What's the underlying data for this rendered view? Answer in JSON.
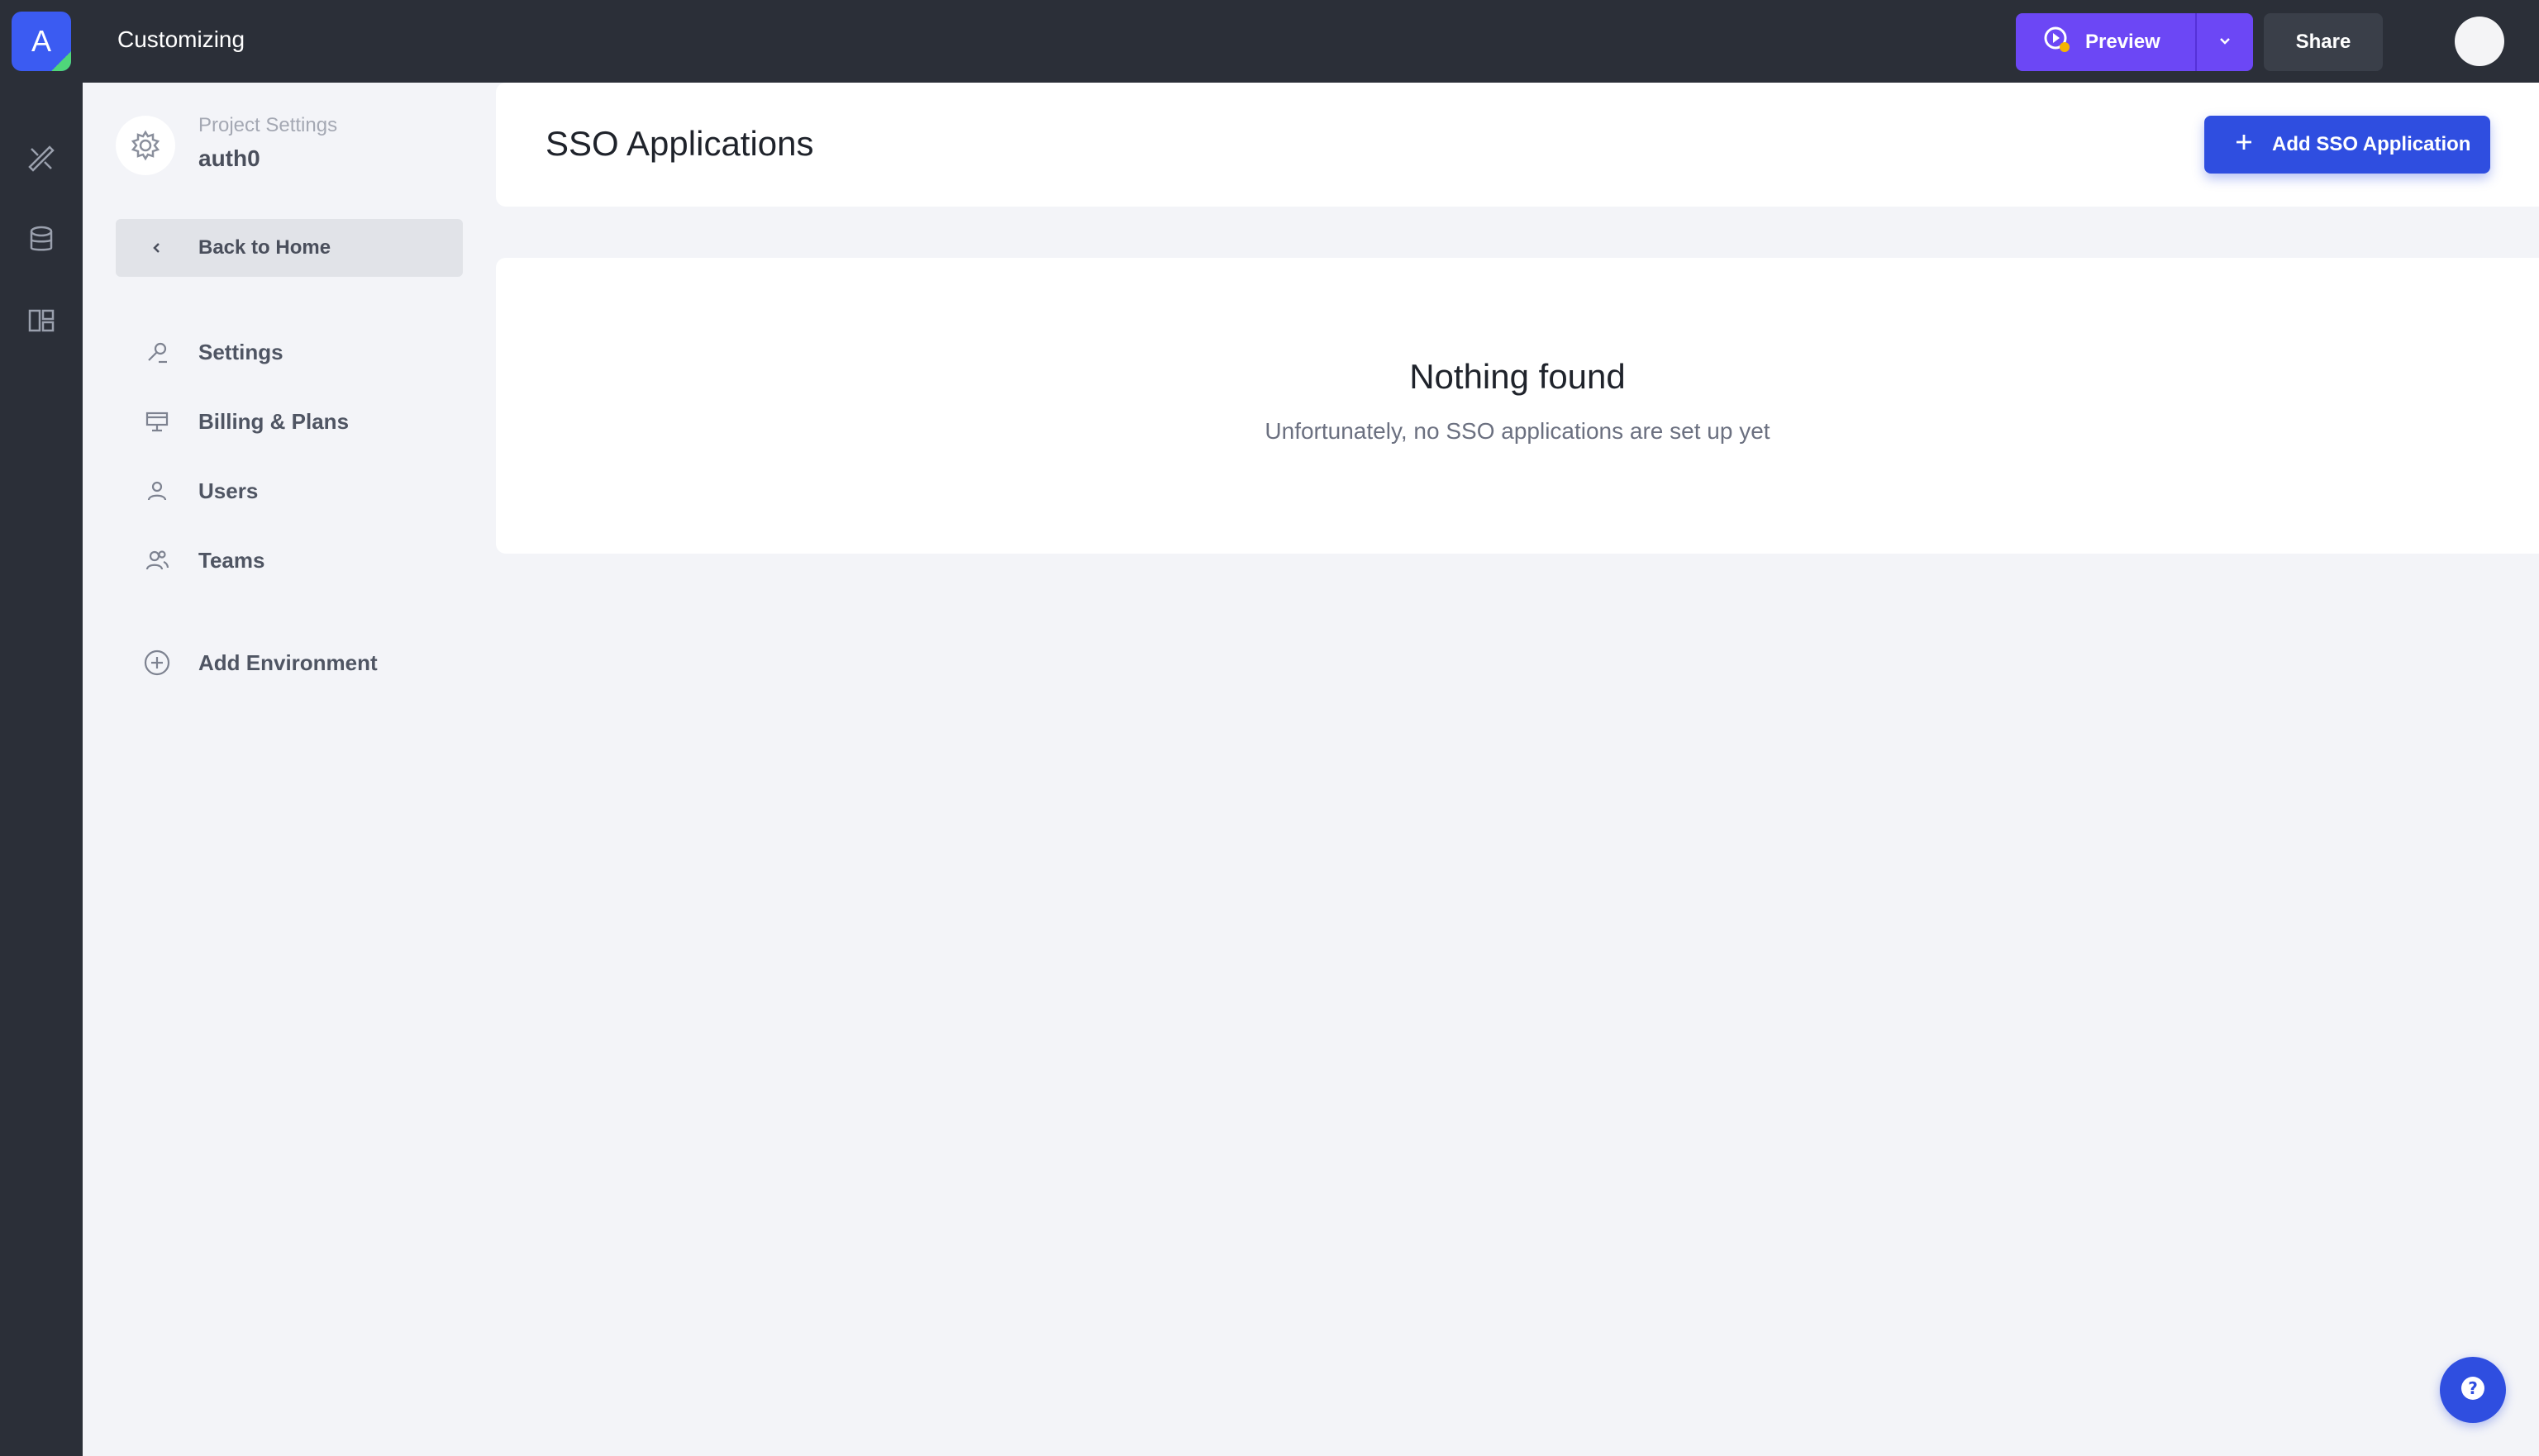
{
  "app": {
    "logo_letter": "A",
    "title": "Customizing"
  },
  "topbar": {
    "preview_label": "Preview",
    "share_label": "Share"
  },
  "sidebar": {
    "caption": "Project Settings",
    "project_name": "auth0",
    "back_label": "Back to Home",
    "items": [
      {
        "label": "Settings",
        "icon": "wrench-icon"
      },
      {
        "label": "Billing & Plans",
        "icon": "billing-icon"
      },
      {
        "label": "Users",
        "icon": "user-icon"
      },
      {
        "label": "Teams",
        "icon": "team-icon"
      }
    ],
    "add_env_label": "Add Environment"
  },
  "main": {
    "title": "SSO Applications",
    "add_button_label": "Add SSO Application",
    "empty_title": "Nothing found",
    "empty_subtitle": "Unfortunately, no SSO applications are set up yet"
  },
  "colors": {
    "accent": "#2f4ee0",
    "preview": "#6c47f5",
    "dark": "#2b2f38"
  }
}
